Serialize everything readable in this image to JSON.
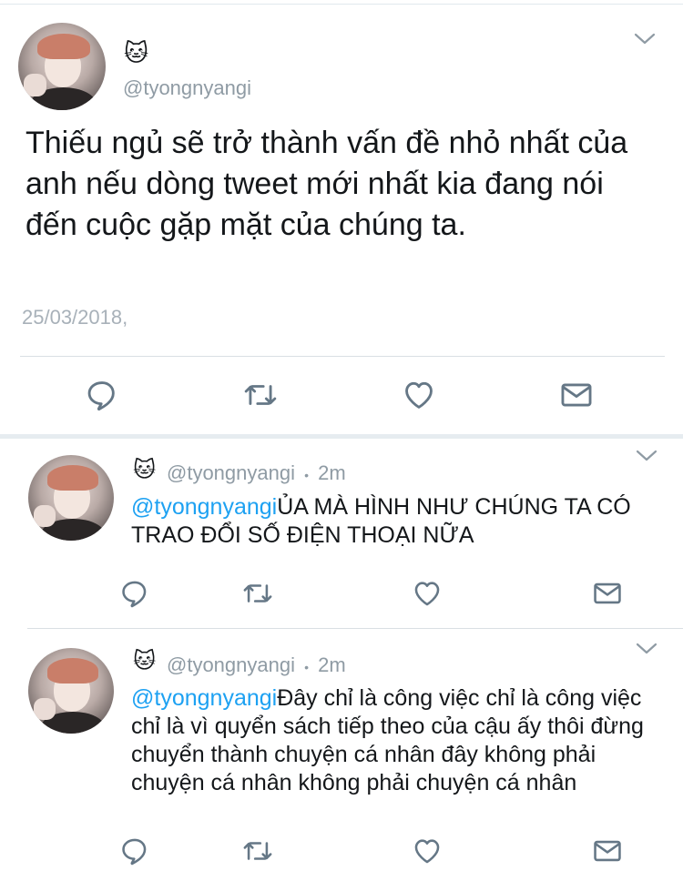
{
  "main_tweet": {
    "name_emoji": "🐱",
    "handle": "@tyongnyangi",
    "text": "Thiếu ngủ sẽ trở thành vấn đề nhỏ nhất của anh nếu dòng tweet mới nhất kia đang nói đến cuộc gặp mặt của chúng ta.",
    "timestamp": "25/03/2018,"
  },
  "replies": [
    {
      "name_emoji": "🐱",
      "handle": "@tyongnyangi",
      "separator": "•",
      "time": "2m",
      "mention": "@tyongnyangi",
      "text": "ỦA MÀ HÌNH NHƯ CHÚNG TA CÓ TRAO ĐỔI SỐ ĐIỆN THOẠI NỮA"
    },
    {
      "name_emoji": "🐱",
      "handle": "@tyongnyangi",
      "separator": "•",
      "time": "2m",
      "mention": "@tyongnyangi",
      "text": "Đây chỉ là công việc chỉ là công việc chỉ là vì quyển sách tiếp theo của cậu ấy thôi đừng chuyển thành chuyện cá nhân đây không phải chuyện cá nhân không phải chuyện cá nhân"
    }
  ],
  "icons": {
    "reply": "reply-icon",
    "retweet": "retweet-icon",
    "like": "heart-icon",
    "dm": "envelope-icon",
    "menu": "chevron-down-icon"
  },
  "colors": {
    "mention": "#1da1f2",
    "secondary": "#8f9ba4",
    "icon": "#657786",
    "divider": "#e6ecf0"
  }
}
